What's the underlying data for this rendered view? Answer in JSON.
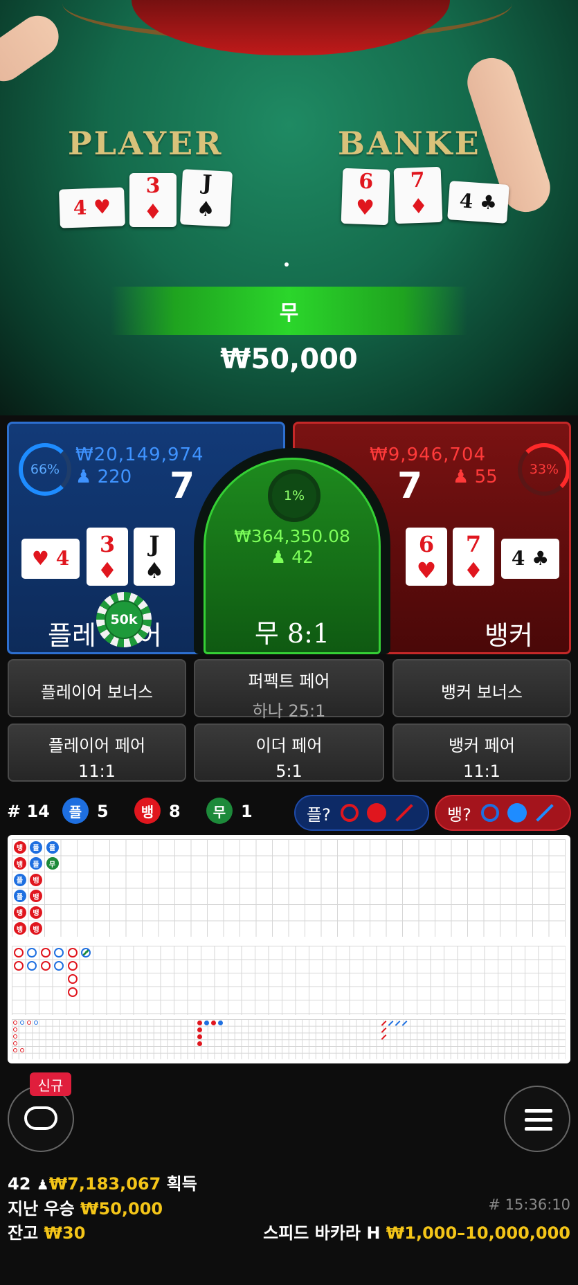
{
  "felt": {
    "player_label": "PLAYER",
    "banker_label": "BANKE",
    "player_cards": [
      {
        "rank": "4",
        "suit": "♥",
        "color": "red"
      },
      {
        "rank": "3",
        "suit": "♦",
        "color": "red"
      },
      {
        "rank": "J",
        "suit": "♠",
        "color": "black"
      }
    ],
    "banker_cards": [
      {
        "rank": "6",
        "suit": "♥",
        "color": "red"
      },
      {
        "rank": "7",
        "suit": "♦",
        "color": "red"
      },
      {
        "rank": "4",
        "suit": "♣",
        "color": "black"
      }
    ]
  },
  "result": {
    "label": "무",
    "win_amount": "₩50,000"
  },
  "bets": {
    "player": {
      "percent": "66%",
      "amount": "₩20,149,974",
      "players": "220",
      "score": "7",
      "label": "플레이어",
      "label_visible": "플레",
      "label_tail": "어",
      "chip": "50k",
      "cards": [
        {
          "rank": "4",
          "suit": "♥",
          "color": "red"
        },
        {
          "rank": "3",
          "suit": "♦",
          "color": "red"
        },
        {
          "rank": "J",
          "suit": "♠",
          "color": "black"
        }
      ]
    },
    "tie": {
      "percent": "1%",
      "amount": "₩364,350.08",
      "players": "42",
      "label": "무 8:1"
    },
    "banker": {
      "percent": "33%",
      "amount": "₩9,946,704",
      "players": "55",
      "score": "7",
      "label": "뱅커",
      "cards": [
        {
          "rank": "6",
          "suit": "♥",
          "color": "red"
        },
        {
          "rank": "7",
          "suit": "♦",
          "color": "red"
        },
        {
          "rank": "4",
          "suit": "♣",
          "color": "black"
        }
      ]
    }
  },
  "side_bets": {
    "player_bonus": "플레이어 보너스",
    "perfect_pair": "퍼펙트 페어",
    "perfect_pair_odds": "하나 25:1",
    "banker_bonus": "뱅커 보너스",
    "player_pair": "플레이어 페어",
    "player_pair_odds": "11:1",
    "either_pair": "이더 페어",
    "either_pair_odds": "5:1",
    "banker_pair": "뱅커 페어",
    "banker_pair_odds": "11:1"
  },
  "summary": {
    "round": "# 14",
    "player_badge": "플",
    "player_count": "5",
    "banker_badge": "뱅",
    "banker_count": "8",
    "tie_badge": "무",
    "tie_count": "1",
    "ask_player": "플?",
    "ask_banker": "뱅?"
  },
  "colors": {
    "player": "#1e6fe0",
    "banker": "#e0161e",
    "tie": "#1d8a3a",
    "gold": "#f4c518"
  },
  "roadmap": {
    "bead_road": [
      [
        "뱅",
        "뱅",
        "플",
        "플",
        "뱅",
        "뱅"
      ],
      [
        "플",
        "플",
        "뱅",
        "뱅",
        "뱅",
        "뱅"
      ],
      [
        "플",
        "무"
      ]
    ]
  },
  "bottom": {
    "new_badge": "신규",
    "players": "42",
    "total_win": "₩7,183,067",
    "total_win_suffix": "획득",
    "last_win_label": "지난 우승",
    "last_win_amount": "₩50,000",
    "game_id": "# 15:36:10",
    "balance_label": "잔고",
    "balance_amount": "₩30",
    "table_name": "스피드 바카라 H",
    "limits": "₩1,000–10,000,000"
  },
  "icons": {
    "lobby": "lobby-icon",
    "menu": "menu-icon",
    "person": "person-icon"
  }
}
